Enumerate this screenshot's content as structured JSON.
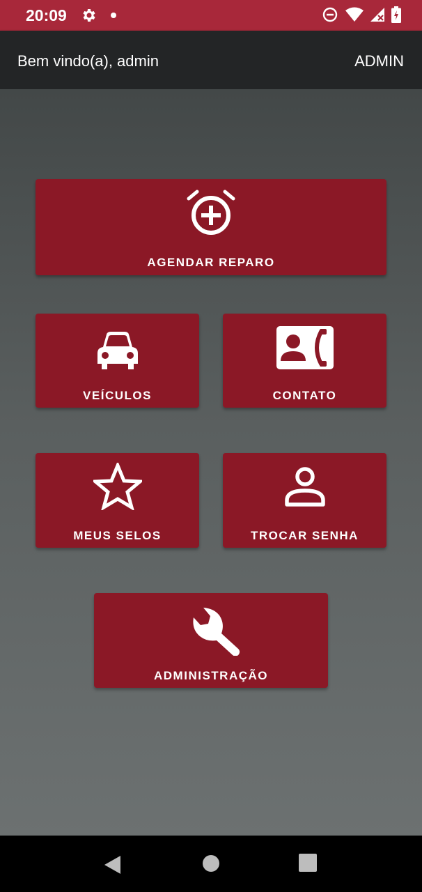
{
  "status_bar": {
    "time": "20:09",
    "icons": [
      "settings-icon",
      "notification-dot",
      "do-not-disturb-icon",
      "wifi-icon",
      "signal-icon",
      "battery-icon"
    ]
  },
  "app_bar": {
    "welcome": "Bem vindo(a), admin",
    "role": "ADMIN"
  },
  "menu": {
    "agendar": {
      "label": "AGENDAR REPARO",
      "icon": "alarm-add-icon"
    },
    "veiculos": {
      "label": "VEÍCULOS",
      "icon": "car-icon"
    },
    "contato": {
      "label": "CONTATO",
      "icon": "contact-phone-icon"
    },
    "selos": {
      "label": "MEUS SELOS",
      "icon": "star-icon"
    },
    "senha": {
      "label": "TROCAR SENHA",
      "icon": "person-icon"
    },
    "admin": {
      "label": "ADMINISTRAÇÃO",
      "icon": "wrench-icon"
    }
  },
  "colors": {
    "status_bar": "#a8283a",
    "app_bar": "#232526",
    "tile": "#8b1826"
  },
  "nav_bar": {
    "icons": [
      "back-icon",
      "home-icon",
      "recents-icon"
    ]
  }
}
